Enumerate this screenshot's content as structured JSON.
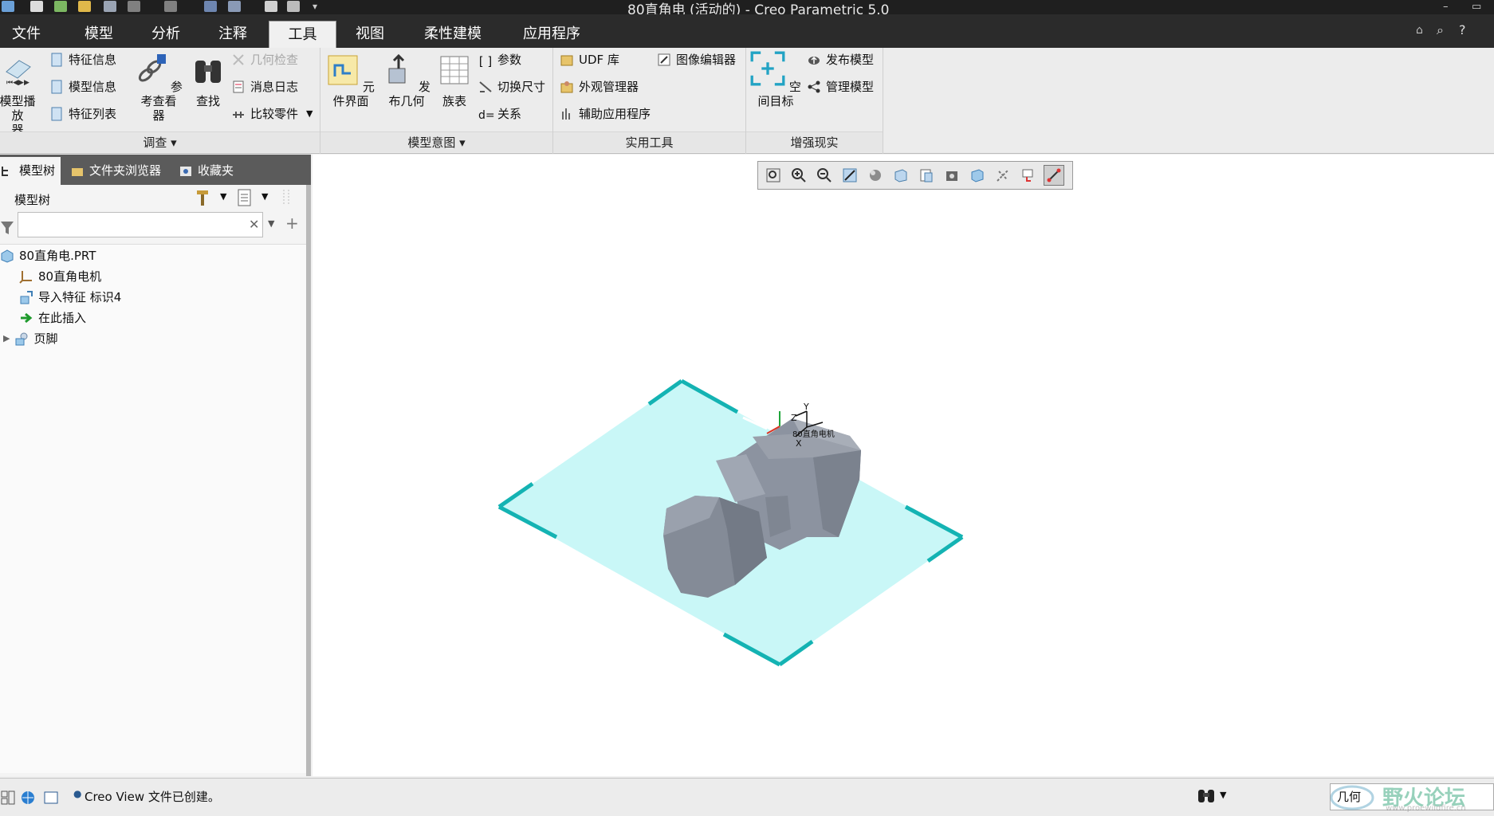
{
  "window": {
    "title": "80直角电 (活动的) - Creo Parametric 5.0"
  },
  "menu": {
    "tabs": [
      "文件",
      "模型",
      "分析",
      "注释",
      "工具",
      "视图",
      "柔性建模",
      "应用程序"
    ],
    "active": "工具"
  },
  "ribbon": {
    "investigate": {
      "label": "调查",
      "model_player": "模型播放\n器",
      "feature_info": "特征信息",
      "model_info": "模型信息",
      "feature_list": "特征列表",
      "reference_viewer": "参考查看\n器",
      "find": "查找",
      "geometry_check": "几何检查",
      "message_log": "消息日志",
      "compare_part": "比较零件"
    },
    "model_intent": {
      "label": "模型意图",
      "component_interface": "元件界面",
      "publish_geometry": "发布几何",
      "family_table": "族表",
      "parameters": "参数",
      "switch_dimensions": "切换尺寸",
      "relations": "关系"
    },
    "utilities": {
      "label": "实用工具",
      "udf_library": "UDF 库",
      "image_editor": "图像编辑器",
      "appearance_manager": "外观管理器",
      "auxiliary_apps": "辅助应用程序"
    },
    "ar": {
      "label": "增强现实",
      "spatial_target": "空间目标",
      "publish_model": "发布模型",
      "manage_model": "管理模型"
    }
  },
  "panel": {
    "tabs": [
      "模型树",
      "文件夹浏览器",
      "收藏夹"
    ],
    "header": "模型树",
    "search": {
      "value": "",
      "placeholder": ""
    },
    "tree": [
      "80直角电.PRT",
      "80直角电机",
      "导入特征 标识4",
      "在此插入",
      "页脚"
    ]
  },
  "viewport": {
    "csys_label": "80直角电机",
    "axis_labels": [
      "X",
      "Y",
      "Z"
    ]
  },
  "status": {
    "message": "Creo View 文件已创建。",
    "filter": "几何"
  },
  "watermark": {
    "text": "野火论坛",
    "url": "www.proewildfire.cn"
  },
  "colors": {
    "plane_fill": "#c9f7f7",
    "plane_corner": "#14b3b3",
    "part": "#8c93a0",
    "menubar": "#2b2b2b"
  }
}
